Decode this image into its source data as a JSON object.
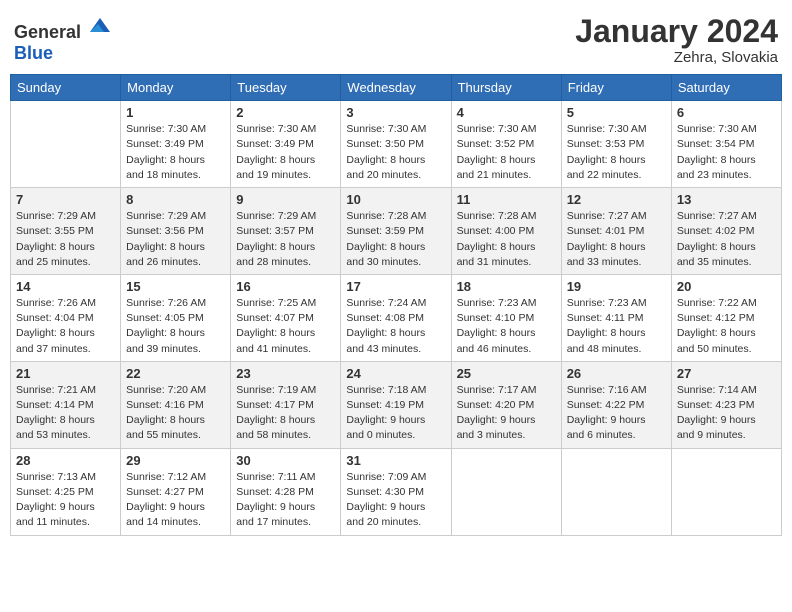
{
  "logo": {
    "text_general": "General",
    "text_blue": "Blue"
  },
  "header": {
    "month_year": "January 2024",
    "location": "Zehra, Slovakia"
  },
  "weekdays": [
    "Sunday",
    "Monday",
    "Tuesday",
    "Wednesday",
    "Thursday",
    "Friday",
    "Saturday"
  ],
  "weeks": [
    [
      {
        "day": "",
        "info": ""
      },
      {
        "day": "1",
        "info": "Sunrise: 7:30 AM\nSunset: 3:49 PM\nDaylight: 8 hours\nand 18 minutes."
      },
      {
        "day": "2",
        "info": "Sunrise: 7:30 AM\nSunset: 3:49 PM\nDaylight: 8 hours\nand 19 minutes."
      },
      {
        "day": "3",
        "info": "Sunrise: 7:30 AM\nSunset: 3:50 PM\nDaylight: 8 hours\nand 20 minutes."
      },
      {
        "day": "4",
        "info": "Sunrise: 7:30 AM\nSunset: 3:52 PM\nDaylight: 8 hours\nand 21 minutes."
      },
      {
        "day": "5",
        "info": "Sunrise: 7:30 AM\nSunset: 3:53 PM\nDaylight: 8 hours\nand 22 minutes."
      },
      {
        "day": "6",
        "info": "Sunrise: 7:30 AM\nSunset: 3:54 PM\nDaylight: 8 hours\nand 23 minutes."
      }
    ],
    [
      {
        "day": "7",
        "info": "Sunrise: 7:29 AM\nSunset: 3:55 PM\nDaylight: 8 hours\nand 25 minutes."
      },
      {
        "day": "8",
        "info": "Sunrise: 7:29 AM\nSunset: 3:56 PM\nDaylight: 8 hours\nand 26 minutes."
      },
      {
        "day": "9",
        "info": "Sunrise: 7:29 AM\nSunset: 3:57 PM\nDaylight: 8 hours\nand 28 minutes."
      },
      {
        "day": "10",
        "info": "Sunrise: 7:28 AM\nSunset: 3:59 PM\nDaylight: 8 hours\nand 30 minutes."
      },
      {
        "day": "11",
        "info": "Sunrise: 7:28 AM\nSunset: 4:00 PM\nDaylight: 8 hours\nand 31 minutes."
      },
      {
        "day": "12",
        "info": "Sunrise: 7:27 AM\nSunset: 4:01 PM\nDaylight: 8 hours\nand 33 minutes."
      },
      {
        "day": "13",
        "info": "Sunrise: 7:27 AM\nSunset: 4:02 PM\nDaylight: 8 hours\nand 35 minutes."
      }
    ],
    [
      {
        "day": "14",
        "info": "Sunrise: 7:26 AM\nSunset: 4:04 PM\nDaylight: 8 hours\nand 37 minutes."
      },
      {
        "day": "15",
        "info": "Sunrise: 7:26 AM\nSunset: 4:05 PM\nDaylight: 8 hours\nand 39 minutes."
      },
      {
        "day": "16",
        "info": "Sunrise: 7:25 AM\nSunset: 4:07 PM\nDaylight: 8 hours\nand 41 minutes."
      },
      {
        "day": "17",
        "info": "Sunrise: 7:24 AM\nSunset: 4:08 PM\nDaylight: 8 hours\nand 43 minutes."
      },
      {
        "day": "18",
        "info": "Sunrise: 7:23 AM\nSunset: 4:10 PM\nDaylight: 8 hours\nand 46 minutes."
      },
      {
        "day": "19",
        "info": "Sunrise: 7:23 AM\nSunset: 4:11 PM\nDaylight: 8 hours\nand 48 minutes."
      },
      {
        "day": "20",
        "info": "Sunrise: 7:22 AM\nSunset: 4:12 PM\nDaylight: 8 hours\nand 50 minutes."
      }
    ],
    [
      {
        "day": "21",
        "info": "Sunrise: 7:21 AM\nSunset: 4:14 PM\nDaylight: 8 hours\nand 53 minutes."
      },
      {
        "day": "22",
        "info": "Sunrise: 7:20 AM\nSunset: 4:16 PM\nDaylight: 8 hours\nand 55 minutes."
      },
      {
        "day": "23",
        "info": "Sunrise: 7:19 AM\nSunset: 4:17 PM\nDaylight: 8 hours\nand 58 minutes."
      },
      {
        "day": "24",
        "info": "Sunrise: 7:18 AM\nSunset: 4:19 PM\nDaylight: 9 hours\nand 0 minutes."
      },
      {
        "day": "25",
        "info": "Sunrise: 7:17 AM\nSunset: 4:20 PM\nDaylight: 9 hours\nand 3 minutes."
      },
      {
        "day": "26",
        "info": "Sunrise: 7:16 AM\nSunset: 4:22 PM\nDaylight: 9 hours\nand 6 minutes."
      },
      {
        "day": "27",
        "info": "Sunrise: 7:14 AM\nSunset: 4:23 PM\nDaylight: 9 hours\nand 9 minutes."
      }
    ],
    [
      {
        "day": "28",
        "info": "Sunrise: 7:13 AM\nSunset: 4:25 PM\nDaylight: 9 hours\nand 11 minutes."
      },
      {
        "day": "29",
        "info": "Sunrise: 7:12 AM\nSunset: 4:27 PM\nDaylight: 9 hours\nand 14 minutes."
      },
      {
        "day": "30",
        "info": "Sunrise: 7:11 AM\nSunset: 4:28 PM\nDaylight: 9 hours\nand 17 minutes."
      },
      {
        "day": "31",
        "info": "Sunrise: 7:09 AM\nSunset: 4:30 PM\nDaylight: 9 hours\nand 20 minutes."
      },
      {
        "day": "",
        "info": ""
      },
      {
        "day": "",
        "info": ""
      },
      {
        "day": "",
        "info": ""
      }
    ]
  ]
}
